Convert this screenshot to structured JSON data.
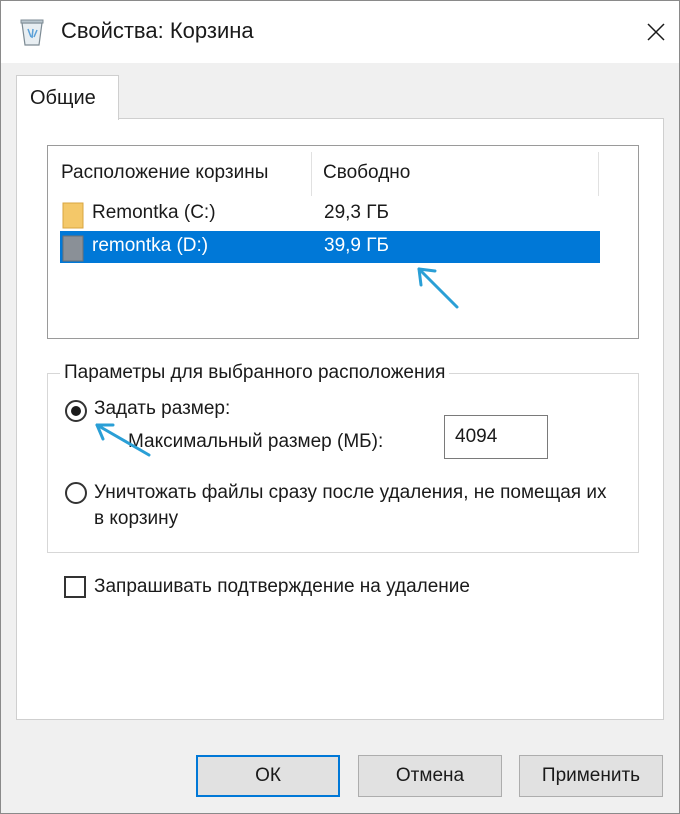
{
  "window": {
    "title": "Свойства: Корзина",
    "icon": "recycle-bin-icon",
    "close_icon": "close-icon"
  },
  "tabs": [
    {
      "label": "Общие",
      "active": true
    }
  ],
  "locations_list": {
    "headers": [
      "Расположение корзины",
      "Свободно"
    ],
    "rows": [
      {
        "name": "Remontka (C:)",
        "free": "29,3 ГБ",
        "selected": false,
        "icon": "folder-icon"
      },
      {
        "name": "remontka (D:)",
        "free": "39,9 ГБ",
        "selected": true,
        "icon": "drive-icon"
      }
    ]
  },
  "settings_group": {
    "legend": "Параметры для выбранного расположения",
    "custom_size": {
      "label": "Задать размер:",
      "checked": true
    },
    "max_size_label": "Максимальный размер (МБ):",
    "max_size_value": "4094",
    "delete_immediately": {
      "label": "Уничтожать файлы сразу после удаления, не помещая их в корзину",
      "checked": false
    }
  },
  "confirm_delete": {
    "label": "Запрашивать подтверждение на удаление",
    "checked": false
  },
  "buttons": {
    "ok": "ОК",
    "cancel": "Отмена",
    "apply": "Применить"
  },
  "colors": {
    "selection": "#0078d7",
    "annotation_arrow": "#2a9fd6"
  }
}
